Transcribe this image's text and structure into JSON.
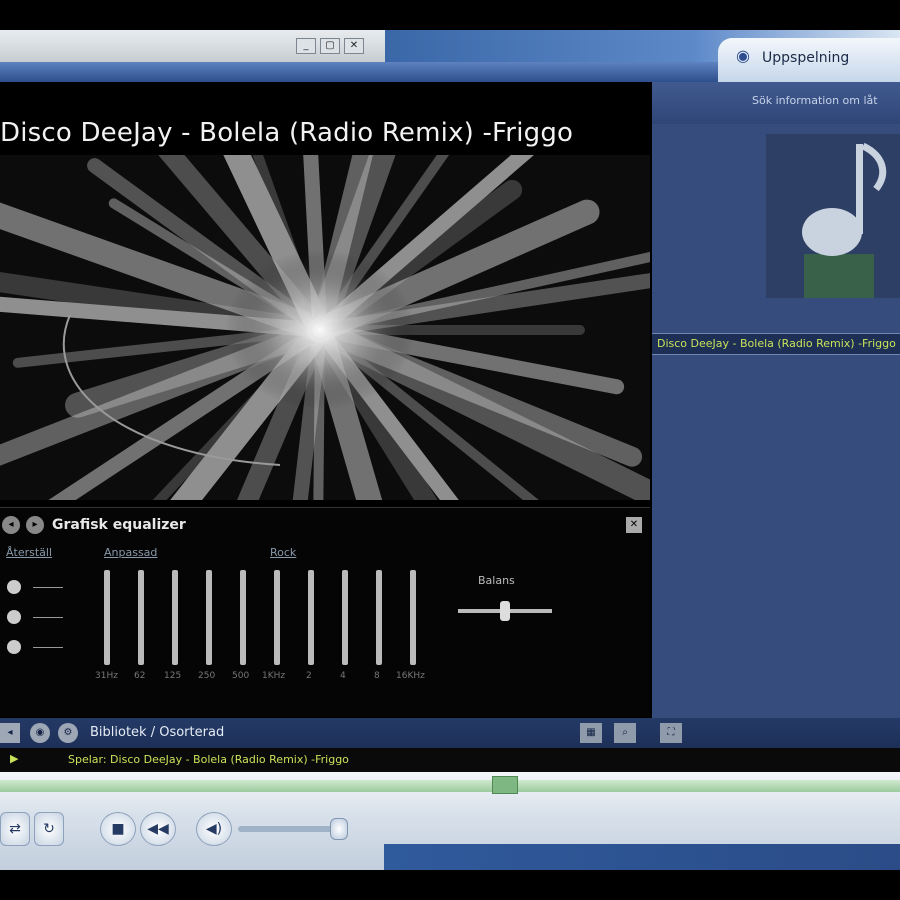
{
  "window": {
    "buttons": {
      "minimize": "_",
      "maximize": "▢",
      "close": "✕"
    },
    "active_tab": "Uppspelning"
  },
  "video": {
    "title": "Disco DeeJay - Bolela (Radio Remix) -Friggo"
  },
  "equalizer": {
    "title": "Grafisk equalizer",
    "link_reset": "Återställ",
    "link_custom": "Anpassad",
    "link_rock": "Rock",
    "balance_label": "Balans",
    "frequencies": [
      "31Hz",
      "62",
      "125",
      "250",
      "500",
      "1KHz",
      "2",
      "4",
      "8",
      "16KHz"
    ]
  },
  "panel": {
    "hint": "Sök information om låt",
    "now_playing": "Disco DeeJay - Bolela (Radio Remix) -Friggo"
  },
  "library": {
    "path": "Bibliotek / Osorterad"
  },
  "status": {
    "text": "Spelar: Disco DeeJay - Bolela (Radio Remix) -Friggo"
  },
  "colors": {
    "accent": "#c8e25a",
    "panel": "#364c7c",
    "title_bar": "#3a67a7"
  }
}
